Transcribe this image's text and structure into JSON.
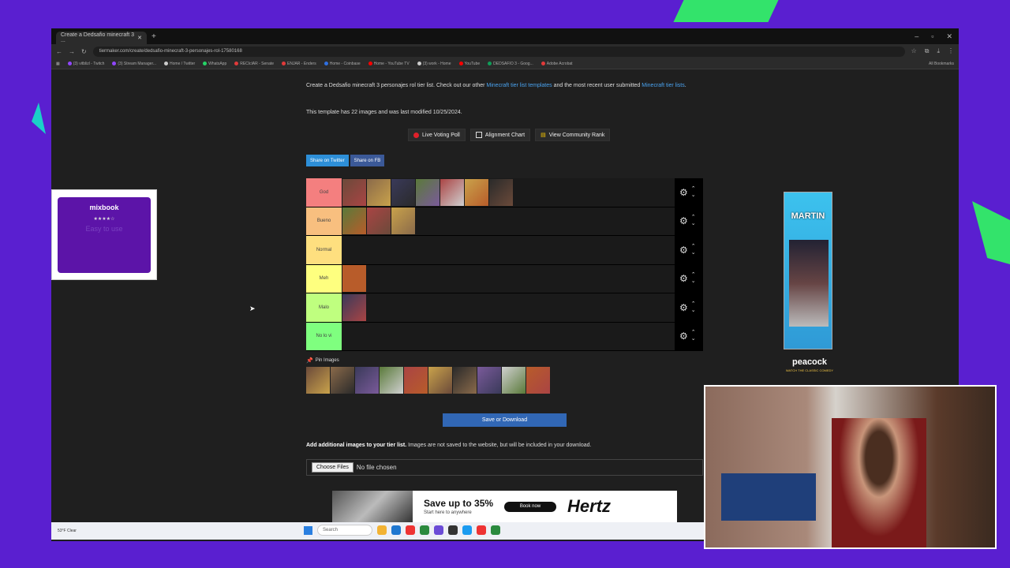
{
  "browser": {
    "tab_title": "Create a Dedsafio minecraft 3 ...",
    "url": "tiermaker.com/create/dedsafio-minecraft-3-personajes-rol-17580168",
    "bookmarks": [
      "(3) vitblizl - Twitch",
      "(3) Stream Manager...",
      "Home / Twitter",
      "WhatsApp",
      "RECIclAR - Senate",
      "ENJAR - Enders",
      "Home - Coinbase",
      "Home - YouTube TV",
      "(3) work - Home",
      "YouTube",
      "DEDSAFIO 3 - Goog...",
      "Adobe Acrobat"
    ],
    "all_bookmarks": "All Bookmarks"
  },
  "page": {
    "intro_text": "Create a Dedsafio minecraft 3 personajes rol tier list. Check out our other ",
    "intro_link1": "Minecraft tier list templates",
    "intro_mid": " and the most recent user submitted ",
    "intro_link2": "Minecraft tier lists",
    "intro_end": ".",
    "meta": "This template has 22 images and was last modified 10/25/2024.",
    "buttons": {
      "live_voting": "Live Voting Poll",
      "alignment": "Alignment Chart",
      "community": "View Community Rank"
    },
    "share_twitter": "Share on Twitter",
    "share_fb": "Share on FB",
    "tiers": [
      {
        "label": "God",
        "color": "#f47f7f",
        "images": 7
      },
      {
        "label": "Bueno",
        "color": "#f8bf7f",
        "images": 3
      },
      {
        "label": "Normal",
        "color": "#fedf7f",
        "images": 0
      },
      {
        "label": "Meh",
        "color": "#feff7f",
        "images": 1
      },
      {
        "label": "Malo",
        "color": "#bfff7f",
        "images": 1
      },
      {
        "label": "No lo vi",
        "color": "#7fff7f",
        "images": 0
      }
    ],
    "pin_images": "Pin Images",
    "pool_count": 10,
    "save_button": "Save or Download",
    "add_images_bold": "Add additional images to your tier list.",
    "add_images_rest": " Images are not saved to the website, but will be included in your download.",
    "choose_files": "Choose Files",
    "no_file": "No file chosen"
  },
  "ads": {
    "mixbook_logo": "mixbook",
    "mixbook_stars": "★★★★☆",
    "mixbook_sub": "Easy to use",
    "martin_title": "MARTIN",
    "peacock": "peacock",
    "peacock_sub": "WATCH THE CLASSIC COMEDY",
    "hertz_headline": "Save up to 35%",
    "hertz_sub": "Start here to anywhere",
    "hertz_cta": "Book now",
    "hertz_logo": "Hertz"
  },
  "taskbar": {
    "weather": "53°F Clear",
    "search": "Search"
  },
  "colors": {
    "accent_purple": "#5a1fd0",
    "save_blue": "#3167b5",
    "twitter_blue": "#2d8fd8"
  }
}
